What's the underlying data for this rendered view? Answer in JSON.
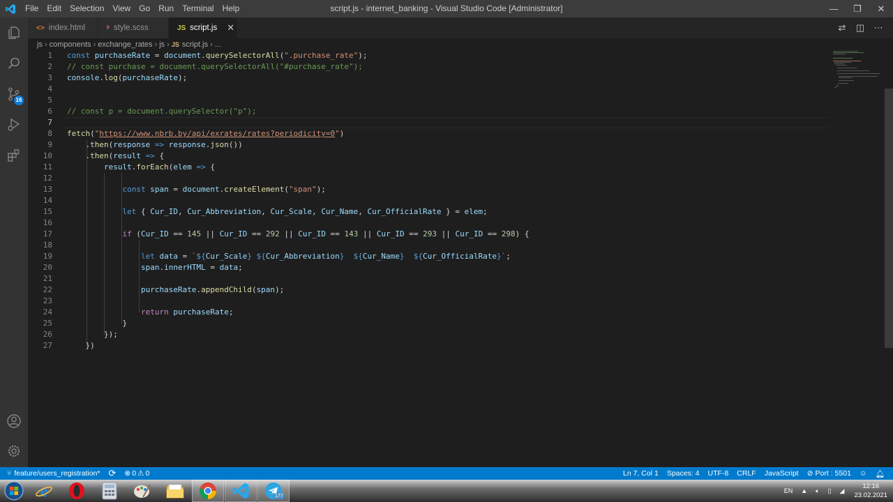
{
  "window": {
    "title": "script.js - internet_banking - Visual Studio Code [Administrator]",
    "menu": [
      "File",
      "Edit",
      "Selection",
      "View",
      "Go",
      "Run",
      "Terminal",
      "Help"
    ],
    "controls": {
      "minimize": "—",
      "maximize": "❐",
      "close": "✕"
    }
  },
  "activity_bar": {
    "source_control_badge": "16",
    "icons": [
      "explorer-icon",
      "search-icon",
      "source-control-icon",
      "run-debug-icon",
      "extensions-icon",
      "account-icon",
      "settings-gear-icon"
    ]
  },
  "tabs": [
    {
      "label": "index.html",
      "icon": "<>",
      "icon_color": "#e37933",
      "active": false
    },
    {
      "label": "style.scss",
      "icon": "ᵖ",
      "icon_color": "#cd6799",
      "active": false
    },
    {
      "label": "script.js",
      "icon": "JS",
      "icon_color": "#cbcb41",
      "active": true
    }
  ],
  "breadcrumb": [
    "js",
    "components",
    "exchange_rates",
    "js",
    "script.js",
    "..."
  ],
  "editor": {
    "current_line": 7,
    "lines": [
      {
        "n": "1"
      },
      {
        "n": "2"
      },
      {
        "n": "3"
      },
      {
        "n": "4"
      },
      {
        "n": "5"
      },
      {
        "n": "6"
      },
      {
        "n": "7"
      },
      {
        "n": "8"
      },
      {
        "n": "9"
      },
      {
        "n": "10"
      },
      {
        "n": "11"
      },
      {
        "n": "12"
      },
      {
        "n": "13"
      },
      {
        "n": "14"
      },
      {
        "n": "15"
      },
      {
        "n": "16"
      },
      {
        "n": "17"
      },
      {
        "n": "18"
      },
      {
        "n": "19"
      },
      {
        "n": "20"
      },
      {
        "n": "21"
      },
      {
        "n": "22"
      },
      {
        "n": "23"
      },
      {
        "n": "24"
      },
      {
        "n": "25"
      },
      {
        "n": "26"
      },
      {
        "n": "27"
      }
    ],
    "code": {
      "l1_kw": "const",
      "l1_var": "purchaseRate",
      "l1_eq": " = ",
      "l1_obj": "document",
      "l1_dot": ".",
      "l1_fn": "querySelectorAll",
      "l1_open": "(",
      "l1_str": "\".purchase_rate\"",
      "l1_close": ");",
      "l2": "// const purchase = document.querySelectorAll(\"#purchase_rate\");",
      "l3_obj": "console",
      "l3_dot": ".",
      "l3_fn": "log",
      "l3_open": "(",
      "l3_var": "purchaseRate",
      "l3_close": ");",
      "l6": "// const p = document.querySelector(\"p\");",
      "l8_fn": "fetch",
      "l8_open": "(",
      "l8_q1": "\"",
      "l8_url": "https://www.nbrb.by/api/exrates/rates?periodicity=0",
      "l8_q2": "\"",
      "l8_close": ")",
      "l9_dot": ".",
      "l9_fn": "then",
      "l9_open": "(",
      "l9_param": "response",
      "l9_arrow": " => ",
      "l9_var": "response",
      "l9_dot2": ".",
      "l9_fn2": "json",
      "l9_close": "())",
      "l10_dot": ".",
      "l10_fn": "then",
      "l10_open": "(",
      "l10_param": "result",
      "l10_arrow": " => ",
      "l10_brace": "{",
      "l11_var": "result",
      "l11_dot": ".",
      "l11_fn": "forEach",
      "l11_open": "(",
      "l11_param": "elem",
      "l11_arrow": " => ",
      "l11_brace": "{",
      "l13_kw": "const",
      "l13_var": "span",
      "l13_eq": " = ",
      "l13_obj": "document",
      "l13_dot": ".",
      "l13_fn": "createElement",
      "l13_open": "(",
      "l13_str": "\"span\"",
      "l13_close": ");",
      "l15_kw": "let",
      "l15_open": " { ",
      "l15_v1": "Cur_ID",
      "l15_c1": ", ",
      "l15_v2": "Cur_Abbreviation",
      "l15_c2": ", ",
      "l15_v3": "Cur_Scale",
      "l15_c3": ", ",
      "l15_v4": "Cur_Name",
      "l15_c4": ", ",
      "l15_v5": "Cur_OfficialRate",
      "l15_close": " } = ",
      "l15_v6": "elem",
      "l15_end": ";",
      "l17_kw": "if",
      "l17_p0": " (",
      "l17_v1": "Cur_ID",
      "l17_op1": " == ",
      "l17_n1": "145",
      "l17_or1": " || ",
      "l17_v2": "Cur_ID",
      "l17_op2": " == ",
      "l17_n2": "292",
      "l17_or2": " || ",
      "l17_v3": "Cur_ID",
      "l17_op3": " == ",
      "l17_n3": "143",
      "l17_or3": " || ",
      "l17_v4": "Cur_ID",
      "l17_op4": " == ",
      "l17_n4": "293",
      "l17_or4": " || ",
      "l17_v5": "Cur_ID",
      "l17_op5": " == ",
      "l17_n5": "298",
      "l17_end": ") {",
      "l19_kw": "let",
      "l19_var": "data",
      "l19_eq": " = ",
      "l19_t0": "`",
      "l19_d1": "${",
      "l19_v1": "Cur_Scale",
      "l19_e1": "}",
      "l19_s1": " ",
      "l19_d2": "${",
      "l19_v2": "Cur_Abbreviation",
      "l19_e2": "}",
      "l19_s2": "  ",
      "l19_d3": "${",
      "l19_v3": "Cur_Name",
      "l19_e3": "}",
      "l19_s3": "  ",
      "l19_d4": "${",
      "l19_v4": "Cur_OfficialRate",
      "l19_e4": "}",
      "l19_t1": "`",
      "l19_end": ";",
      "l20_var": "span",
      "l20_dot": ".",
      "l20_prop": "innerHTML",
      "l20_eq": " = ",
      "l20_val": "data",
      "l20_end": ";",
      "l22_var": "purchaseRate",
      "l22_dot": ".",
      "l22_fn": "appendChild",
      "l22_open": "(",
      "l22_arg": "span",
      "l22_close": ");",
      "l24_kw": "return",
      "l24_var": "purchaseRate",
      "l24_end": ";",
      "l25": "}",
      "l26": "});",
      "l27": "})"
    }
  },
  "status_bar": {
    "branch": "feature/users_registration*",
    "sync": "⟳",
    "errors": "0",
    "warnings": "0",
    "position": "Ln 7, Col 1",
    "spaces": "Spaces: 4",
    "encoding": "UTF-8",
    "eol": "CRLF",
    "language": "JavaScript",
    "port": "Port : 5501"
  },
  "taskbar": {
    "apps": [
      "start-orb",
      "internet-explorer",
      "opera",
      "calculator",
      "paint",
      "file-explorer",
      "chrome",
      "vscode",
      "telegram"
    ],
    "telegram_badge": "177",
    "language": "EN",
    "time": "12:16",
    "date": "23.02.2021"
  },
  "colors": {
    "accent": "#007acc",
    "editor_bg": "#1e1e1e",
    "keyword": "#569cd6",
    "string": "#ce9178",
    "comment": "#6a9955",
    "function": "#dcdcaa",
    "variable": "#9cdcfe",
    "number": "#b5cea8",
    "control": "#c586c0"
  }
}
